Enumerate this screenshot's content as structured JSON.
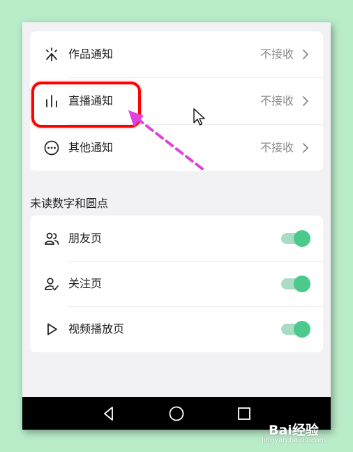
{
  "notifications": {
    "items": [
      {
        "label": "作品通知",
        "value": "不接收",
        "icon": "spark-icon"
      },
      {
        "label": "直播通知",
        "value": "不接收",
        "icon": "bar-chart-icon"
      },
      {
        "label": "其他通知",
        "value": "不接收",
        "icon": "more-circle-icon"
      }
    ]
  },
  "unread": {
    "title": "未读数字和圆点",
    "items": [
      {
        "label": "朋友页",
        "icon": "friends-icon",
        "enabled": true
      },
      {
        "label": "关注页",
        "icon": "follow-icon",
        "enabled": true
      },
      {
        "label": "视频播放页",
        "icon": "play-icon",
        "enabled": true
      }
    ]
  },
  "navbar": {
    "buttons": [
      "back-icon",
      "home-icon",
      "recents-icon"
    ]
  },
  "watermark": {
    "logo": "Bai经验",
    "url": "jingyan.baidu.com"
  },
  "colors": {
    "accent": "#4cc98d",
    "highlight": "#ff0000",
    "arrow": "#e040e0",
    "background": "#b9ecc9"
  }
}
